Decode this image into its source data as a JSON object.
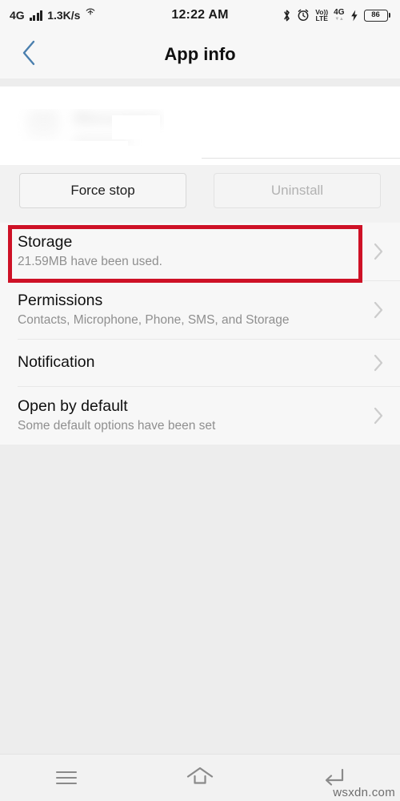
{
  "status_bar": {
    "network_type": "4G",
    "signal_icon": "signal-bars-icon",
    "data_speed": "1.3K/s",
    "hotspot_icon": "hotspot-icon",
    "clock": "12:22 AM",
    "bluetooth_icon": "bluetooth-icon",
    "alarm_icon": "alarm-clock-icon",
    "volte_top": "Vo))",
    "volte_bottom": "LTE",
    "data_network": "4G",
    "data_arrows": "▼▲",
    "charging_icon": "lightning-bolt-icon",
    "battery_level": "86"
  },
  "app_bar": {
    "back_icon": "back-chevron-icon",
    "title": "App info"
  },
  "app_card": {
    "app_name_redacted": "Messages",
    "note": "app icon, name and version are blurred/redacted"
  },
  "actions": {
    "force_stop_label": "Force stop",
    "uninstall_label": "Uninstall"
  },
  "settings_rows": [
    {
      "title": "Storage",
      "subtitle": "21.59MB have been used.",
      "chevron": "chevron-right-icon",
      "highlighted": true
    },
    {
      "title": "Permissions",
      "subtitle": "Contacts, Microphone, Phone, SMS, and Storage",
      "chevron": "chevron-right-icon",
      "highlighted": false
    },
    {
      "title": "Notification",
      "subtitle": "",
      "chevron": "chevron-right-icon",
      "highlighted": false
    },
    {
      "title": "Open by default",
      "subtitle": "Some default options have been set",
      "chevron": "chevron-right-icon",
      "highlighted": false
    }
  ],
  "annotation": {
    "color": "#ce1126",
    "target": "Storage"
  },
  "nav_bar": {
    "menu_icon": "menu-hamburger-icon",
    "home_icon": "home-icon",
    "back_icon": "back-arrow-icon"
  },
  "watermark": "wsxdn.com",
  "colors": {
    "page_background": "#ededed",
    "surface": "#f7f7f7",
    "accent_back": "#4a7fae",
    "annotation_red": "#ce1126",
    "title_text": "#101010",
    "sub_text": "#8f8f8f",
    "disabled_text": "#b2b2b2"
  }
}
